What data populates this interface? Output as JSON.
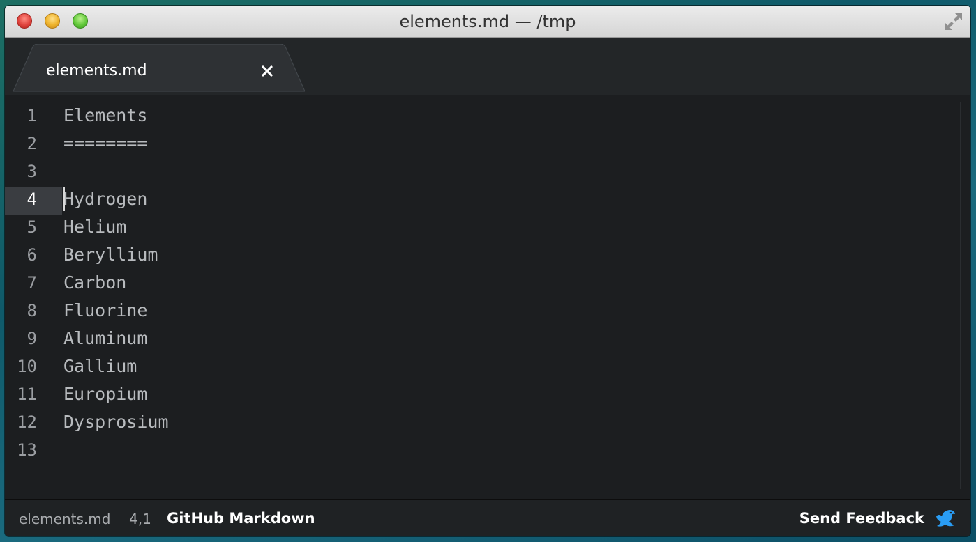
{
  "window": {
    "title": "elements.md — /tmp"
  },
  "tabs": [
    {
      "label": "elements.md",
      "close_glyph": "×"
    }
  ],
  "editor": {
    "current_line": 4,
    "lines": [
      {
        "number": "1",
        "text": "Elements"
      },
      {
        "number": "2",
        "text": "========"
      },
      {
        "number": "3",
        "text": ""
      },
      {
        "number": "4",
        "text": "Hydrogen"
      },
      {
        "number": "5",
        "text": "Helium"
      },
      {
        "number": "6",
        "text": "Beryllium"
      },
      {
        "number": "7",
        "text": "Carbon"
      },
      {
        "number": "8",
        "text": "Fluorine"
      },
      {
        "number": "9",
        "text": "Aluminum"
      },
      {
        "number": "10",
        "text": "Gallium"
      },
      {
        "number": "11",
        "text": "Europium"
      },
      {
        "number": "12",
        "text": "Dysprosium"
      },
      {
        "number": "13",
        "text": ""
      }
    ]
  },
  "status": {
    "file": "elements.md",
    "position": "4,1",
    "syntax": "GitHub Markdown",
    "feedback": "Send Feedback"
  },
  "colors": {
    "accent": "#2a9df4",
    "editor_bg": "#1c1e20",
    "text": "#b8bbbe"
  },
  "icons": [
    "close-icon",
    "minimize-icon",
    "zoom-icon",
    "fullscreen-icon",
    "tab-close-icon",
    "bird-icon"
  ]
}
